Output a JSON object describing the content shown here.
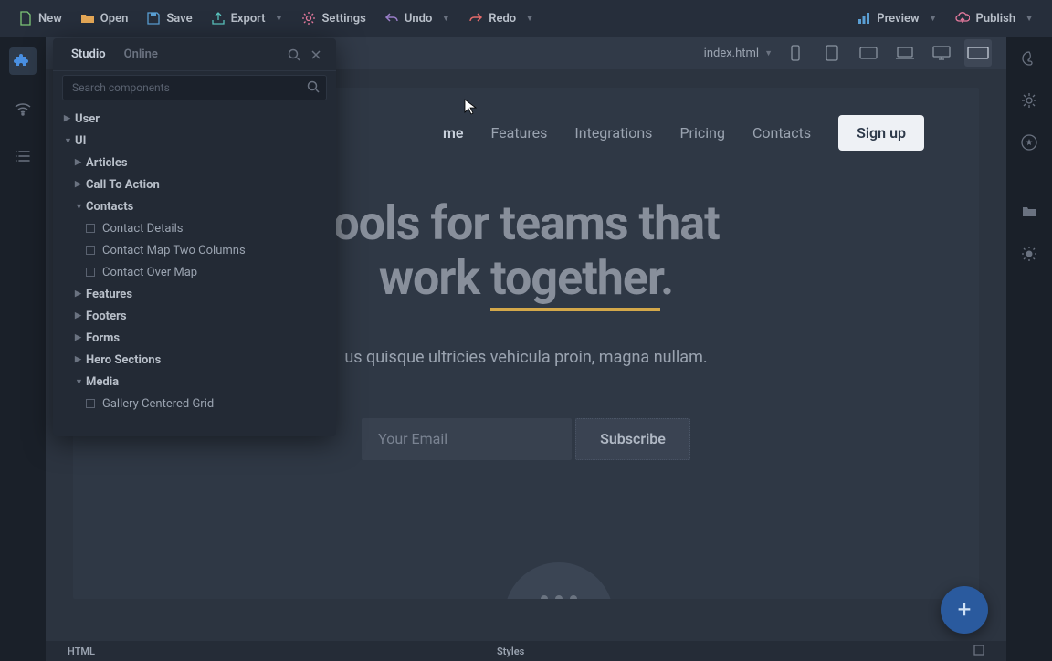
{
  "toolbar": {
    "new_label": "New",
    "open_label": "Open",
    "save_label": "Save",
    "export_label": "Export",
    "settings_label": "Settings",
    "undo_label": "Undo",
    "redo_label": "Redo",
    "preview_label": "Preview",
    "publish_label": "Publish"
  },
  "secondary": {
    "file_name": "index.html"
  },
  "comp_panel": {
    "tab_studio": "Studio",
    "tab_online": "Online",
    "search_placeholder": "Search components",
    "tree": {
      "user": "User",
      "ui": "UI",
      "articles": "Articles",
      "cta": "Call To Action",
      "contacts": "Contacts",
      "contact_details": "Contact Details",
      "contact_map_two": "Contact Map Two Columns",
      "contact_over_map": "Contact Over Map",
      "features": "Features",
      "footers": "Footers",
      "forms": "Forms",
      "hero_sections": "Hero Sections",
      "media": "Media",
      "gallery_centered": "Gallery Centered Grid"
    }
  },
  "page": {
    "nav": {
      "home": "me",
      "features": "Features",
      "integrations": "Integrations",
      "pricing": "Pricing",
      "contacts": "Contacts",
      "signup": "Sign up"
    },
    "hero_line1_a": "ools for teams that",
    "hero_line2_a": "work ",
    "hero_line2_b": "together",
    "hero_line2_c": ".",
    "hero_sub": "us quisque ultricies vehicula proin, magna nullam.",
    "email_placeholder": "Your Email",
    "subscribe": "Subscribe"
  },
  "bottom": {
    "html": "HTML",
    "styles": "Styles"
  }
}
